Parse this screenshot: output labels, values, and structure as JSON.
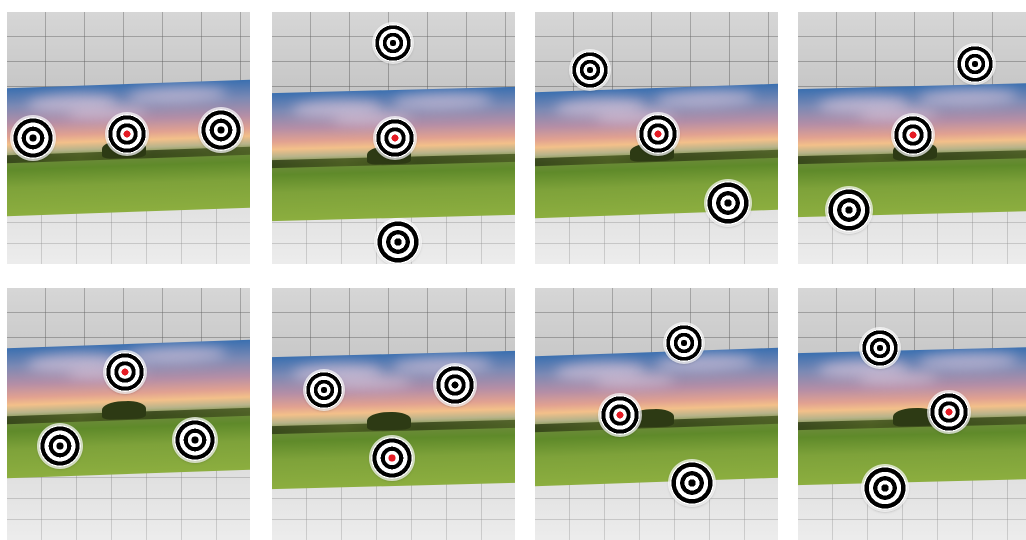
{
  "grid": {
    "colors": {
      "sky_top": "#3a6fb0",
      "sunset": "#f3c08a",
      "grass": "#7ea23a",
      "target_center_red": "#e51b24",
      "target_center_black": "#000000"
    },
    "panels": [
      {
        "targets": [
          {
            "icon": "bullseye-target-icon",
            "center": "black"
          },
          {
            "icon": "bullseye-target-icon",
            "center": "red"
          },
          {
            "icon": "bullseye-target-icon",
            "center": "black"
          }
        ]
      },
      {
        "targets": [
          {
            "icon": "bullseye-target-icon",
            "center": "black"
          },
          {
            "icon": "bullseye-target-icon",
            "center": "red"
          },
          {
            "icon": "bullseye-target-icon",
            "center": "black"
          }
        ]
      },
      {
        "targets": [
          {
            "icon": "bullseye-target-icon",
            "center": "black"
          },
          {
            "icon": "bullseye-target-icon",
            "center": "red"
          },
          {
            "icon": "bullseye-target-icon",
            "center": "black"
          }
        ]
      },
      {
        "targets": [
          {
            "icon": "bullseye-target-icon",
            "center": "black"
          },
          {
            "icon": "bullseye-target-icon",
            "center": "red"
          },
          {
            "icon": "bullseye-target-icon",
            "center": "black"
          }
        ]
      },
      {
        "targets": [
          {
            "icon": "bullseye-target-icon",
            "center": "red"
          },
          {
            "icon": "bullseye-target-icon",
            "center": "black"
          },
          {
            "icon": "bullseye-target-icon",
            "center": "black"
          }
        ]
      },
      {
        "targets": [
          {
            "icon": "bullseye-target-icon",
            "center": "black"
          },
          {
            "icon": "bullseye-target-icon",
            "center": "black"
          },
          {
            "icon": "bullseye-target-icon",
            "center": "red"
          }
        ]
      },
      {
        "targets": [
          {
            "icon": "bullseye-target-icon",
            "center": "black"
          },
          {
            "icon": "bullseye-target-icon",
            "center": "red"
          },
          {
            "icon": "bullseye-target-icon",
            "center": "black"
          }
        ]
      },
      {
        "targets": [
          {
            "icon": "bullseye-target-icon",
            "center": "black"
          },
          {
            "icon": "bullseye-target-icon",
            "center": "red"
          },
          {
            "icon": "bullseye-target-icon",
            "center": "black"
          }
        ]
      }
    ]
  }
}
